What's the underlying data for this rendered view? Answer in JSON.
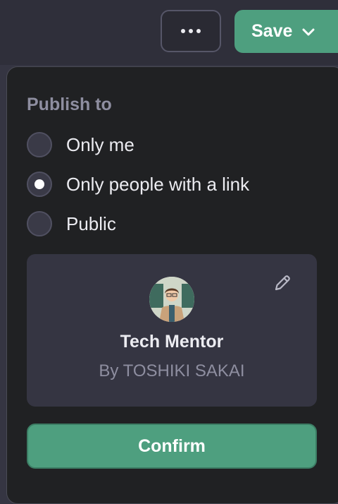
{
  "toolbar": {
    "more_icon": "ellipsis-icon",
    "save_label": "Save",
    "save_icon": "chevron-down-icon"
  },
  "publish": {
    "label": "Publish to",
    "options": [
      {
        "label": "Only me",
        "checked": false
      },
      {
        "label": "Only people with a link",
        "checked": true
      },
      {
        "label": "Public",
        "checked": false
      }
    ]
  },
  "card": {
    "name": "Tech Mentor",
    "author": "By TOSHIKI SAKAI",
    "edit_icon": "pencil-icon",
    "avatar": "avatar-image"
  },
  "confirm_label": "Confirm",
  "colors": {
    "accent": "#4e9f7f",
    "panel": "#202123",
    "card": "#353542",
    "muted_text": "#8e8ea0"
  }
}
